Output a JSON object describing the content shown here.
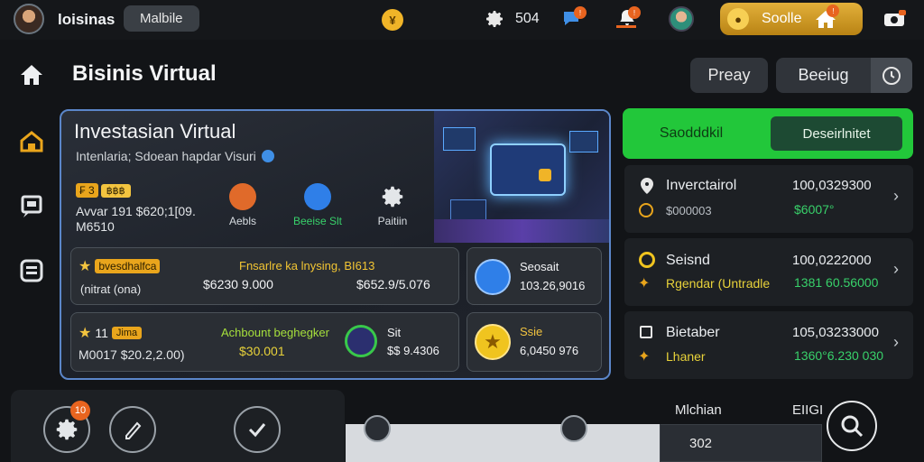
{
  "topbar": {
    "username": "loisinas",
    "mode_pill": "Malbile",
    "coin_symbol": "¥",
    "settings_value": "504",
    "chat_badge": "!",
    "bell_badge": "!",
    "gold_pill_label": "Soolle",
    "home_badge": "!"
  },
  "header": {
    "title": "Bisinis Virtual",
    "btn_preay": "Preay",
    "btn_beeiug": "Beeiug"
  },
  "card": {
    "title": "Investasian Virtual",
    "subtitle": "Intenlaria; Sdoean hapdar Visuri",
    "tag": "₣ 3 ∂∂∂",
    "tag_text": "฿฿฿",
    "tag_prefix": "₣ 3",
    "line1": "Avvar 191 $620;1[09.",
    "line2": "M6510",
    "icons": [
      {
        "label": "Aebls",
        "color": "#e06a2a"
      },
      {
        "label": "Beeise Slt",
        "color": "#2f7fe8"
      },
      {
        "label": "Paitiin",
        "color": "#d8dde2"
      }
    ],
    "row1": {
      "badge_label": "bvesdhalfca",
      "sub": "(nitrat (ona)",
      "title": "Fnsarlre ka lnysing, BI613",
      "val1": "$6230 9.000",
      "val2": "$652.9/5.076"
    },
    "row2": {
      "badge_num": "11",
      "badge_label": "Jima",
      "sub": "M0017 $20.2,2.00)",
      "title": "Achbount beghegker",
      "val1": "$30.001"
    },
    "mini1": {
      "label": "Sit",
      "value": "$$ 9.4306"
    },
    "box1": {
      "label": "Seosait",
      "value": "103.26,9016"
    },
    "box2": {
      "label": "Ssie",
      "value": "6,0450 976"
    }
  },
  "tabs": {
    "active": "Saodddkil",
    "inactive": "Deseirlnitet"
  },
  "right_list": [
    {
      "title": "Inverctairol",
      "amount": "100,0329300",
      "sub_left": "$000003",
      "sub_right": "$6007°"
    },
    {
      "title": "Seisnd",
      "amount": "100,0222000",
      "sub_left": "Rgendar (Untradle",
      "sub_right": "1381 60.56000"
    },
    {
      "title": "Bietaber",
      "amount": "105,03233000",
      "sub_left": "Lhaner",
      "sub_right": "1360°6.230 030"
    }
  ],
  "bottom": {
    "gear_badge": "10",
    "col1_label": "Mlchian",
    "col2_label": "EIIGI",
    "field_value": "302"
  },
  "colors": {
    "accent_green": "#22c73a",
    "accent_gold": "#e2b03a",
    "accent_blue": "#5b86c9",
    "orange": "#e8641f"
  }
}
